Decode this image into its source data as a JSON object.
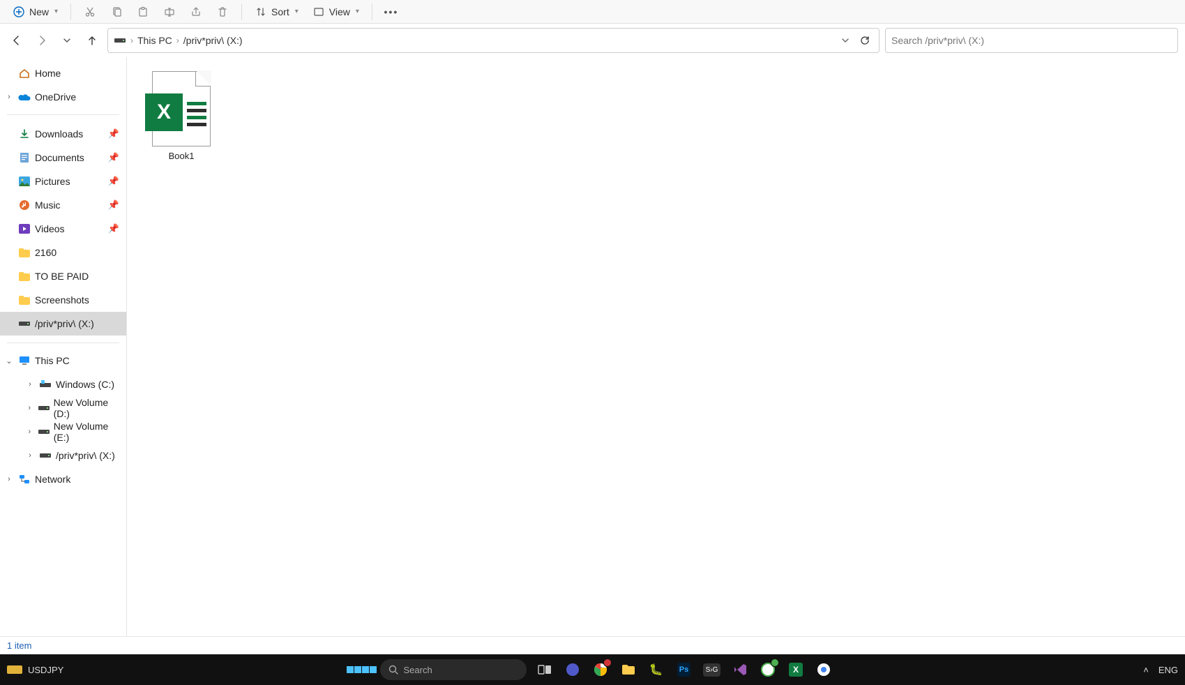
{
  "toolbar": {
    "new_label": "New",
    "sort_label": "Sort",
    "view_label": "View"
  },
  "breadcrumb": {
    "root": "This PC",
    "current": "/priv*priv\\ (X:)"
  },
  "search": {
    "placeholder": "Search /priv*priv\\ (X:)"
  },
  "sidebar": {
    "home": "Home",
    "onedrive": "OneDrive",
    "quick": [
      {
        "label": "Downloads",
        "pinned": true,
        "icon": "download"
      },
      {
        "label": "Documents",
        "pinned": true,
        "icon": "document"
      },
      {
        "label": "Pictures",
        "pinned": true,
        "icon": "pictures"
      },
      {
        "label": "Music",
        "pinned": true,
        "icon": "music"
      },
      {
        "label": "Videos",
        "pinned": true,
        "icon": "videos"
      },
      {
        "label": "2160",
        "pinned": false,
        "icon": "folder"
      },
      {
        "label": "TO BE PAID",
        "pinned": false,
        "icon": "folder"
      },
      {
        "label": "Screenshots",
        "pinned": false,
        "icon": "folder"
      },
      {
        "label": "/priv*priv\\ (X:)",
        "pinned": false,
        "icon": "drive",
        "active": true
      }
    ],
    "thispc": {
      "label": "This PC",
      "children": [
        {
          "label": "Windows (C:)",
          "icon": "drive-win"
        },
        {
          "label": "New Volume (D:)",
          "icon": "drive"
        },
        {
          "label": "New Volume (E:)",
          "icon": "drive"
        },
        {
          "label": "/priv*priv\\ (X:)",
          "icon": "drive"
        }
      ]
    },
    "network": "Network"
  },
  "files": [
    {
      "name": "Book1",
      "type": "xlsx"
    }
  ],
  "status": {
    "count_text": "1 item"
  },
  "taskbar": {
    "ticker": "USDJPY",
    "search_placeholder": "Search",
    "lang": "ENG"
  }
}
